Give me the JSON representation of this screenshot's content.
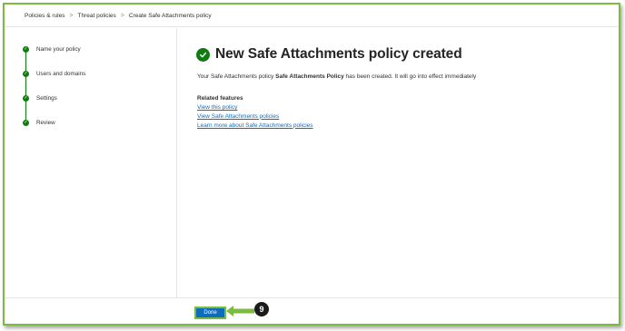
{
  "breadcrumb": {
    "items": [
      "Policies & rules",
      "Threat policies",
      "Create Safe Attachments policy"
    ],
    "separator": ">"
  },
  "wizard": {
    "steps": [
      {
        "label": "Name your policy",
        "status": "complete"
      },
      {
        "label": "Users and domains",
        "status": "complete"
      },
      {
        "label": "Settings",
        "status": "complete"
      },
      {
        "label": "Review",
        "status": "complete"
      }
    ],
    "step_icon": "checkmark-icon",
    "complete_color": "#107c10"
  },
  "main": {
    "title": "New Safe Attachments policy created",
    "title_icon": "success-check-icon",
    "desc_prefix": "Your Safe Attachments policy ",
    "policy_name": "Safe Attachments Policy",
    "desc_suffix": " has been created. It will go into effect immediately",
    "related": {
      "heading": "Related features",
      "links": [
        "View this policy",
        "View Safe Attachments policies",
        "Learn more about Safe Attachments policies"
      ]
    }
  },
  "footer": {
    "done_label": "Done",
    "callout_number": "9"
  },
  "colors": {
    "accent_blue": "#0f6cbd",
    "success_green": "#107c10",
    "annotation_green": "#7cba40"
  }
}
